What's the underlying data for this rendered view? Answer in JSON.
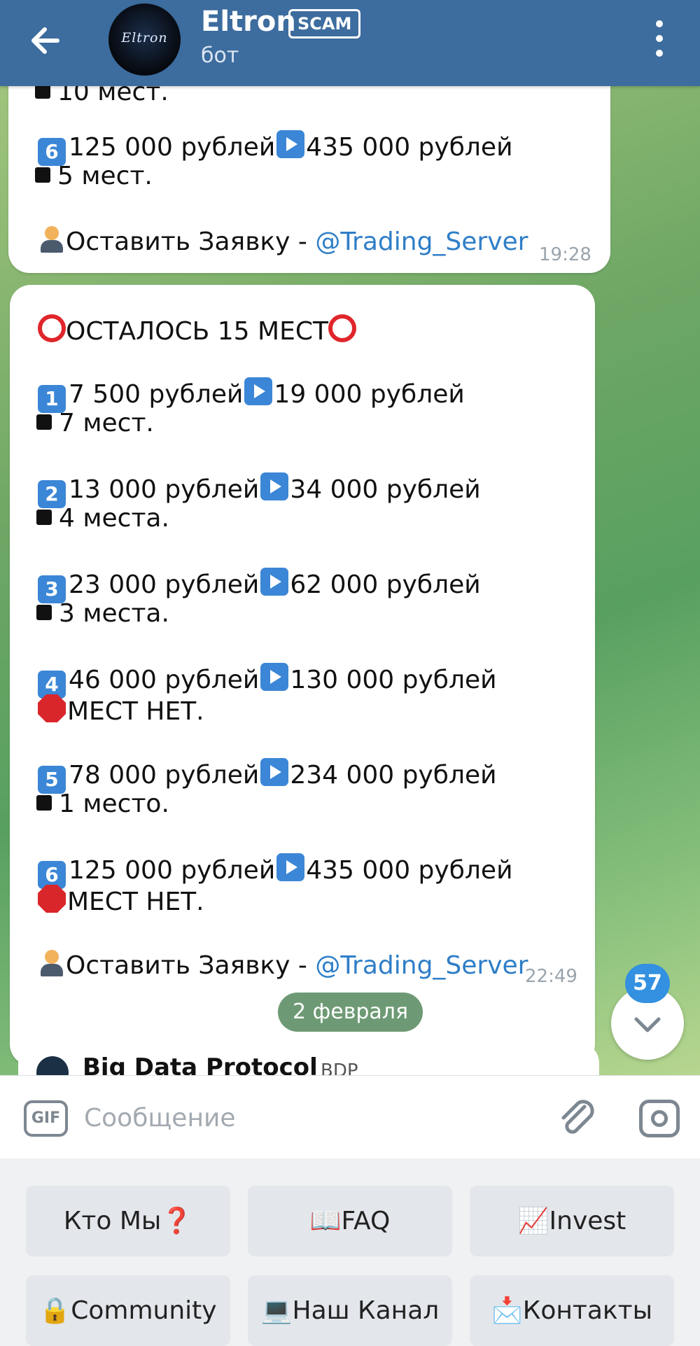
{
  "header": {
    "title": "Eltron",
    "scam_badge": "SCAM",
    "subtitle": "бот",
    "avatar_text": "Eltron"
  },
  "messages": [
    {
      "lines": [
        "10 мест.",
        "6125 000 рублей435 000 рублей",
        "5 мест.",
        "Оставить Заявку - ",
        "@Trading_Server"
      ],
      "time": "19:28"
    },
    {
      "heading": "ОСТАЛОСЬ 15 МЕСТ",
      "offers": [
        {
          "num": "1",
          "from": "7 500 рублей",
          "to": "19 000 рублей",
          "status": "7 мест."
        },
        {
          "num": "2",
          "from": "13 000 рублей",
          "to": "34 000 рублей",
          "status": "4 места."
        },
        {
          "num": "3",
          "from": "23 000 рублей",
          "to": "62 000 рублей",
          "status": "3 места."
        },
        {
          "num": "4",
          "from": "46 000 рублей",
          "to": "130 000 рублей",
          "status": "МЕСТ НЕТ."
        },
        {
          "num": "5",
          "from": "78 000 рублей",
          "to": "234 000 рублей",
          "status": "1 место."
        },
        {
          "num": "6",
          "from": "125 000 рублей",
          "to": "435 000 рублей",
          "status": "МЕСТ НЕТ."
        }
      ],
      "cta": "Оставить Заявку - ",
      "mention": "@Trading_Server",
      "time": "22:49"
    }
  ],
  "first_msg": {
    "cut_line": "10 мест.",
    "num": "6",
    "from": "125 000 рублей",
    "to": "435 000 рублей",
    "status": "5 мест.",
    "cta": "Оставить Заявку - ",
    "mention": "@Trading_Server",
    "time": "19:28"
  },
  "date_separator": "2 февраля",
  "unread_count": "57",
  "next_message": {
    "name": "Big Data Protocol",
    "ticker": "BDP"
  },
  "input": {
    "placeholder": "Сообщение",
    "gif_label": "GIF"
  },
  "keyboard": [
    {
      "icon": "❓",
      "label": "Кто Мы",
      "icon_after": true
    },
    {
      "icon": "📖",
      "label": "FAQ"
    },
    {
      "icon": "📈",
      "label": "Invest"
    },
    {
      "icon": "🔒",
      "label": "Community"
    },
    {
      "icon": "💻",
      "label": "Наш Канал"
    },
    {
      "icon": "📩",
      "label": "Контакты"
    }
  ],
  "colors": {
    "header": "#3d6c9e",
    "accent": "#3490e0",
    "mention": "#2f7ec8"
  }
}
